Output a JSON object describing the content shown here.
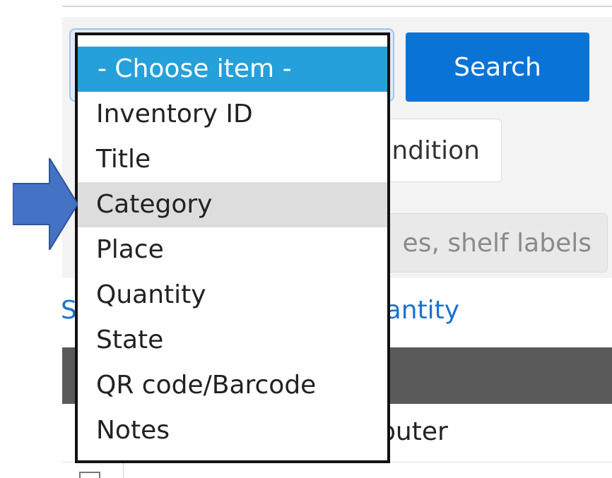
{
  "form": {
    "search_label": "Search",
    "condition_label": "ndition",
    "keyword_placeholder": "es, shelf labels",
    "link_left": "S",
    "link_quantity": "quantity"
  },
  "table": {
    "row_visible_text": "mputer"
  },
  "dropdown": {
    "selected": "- Choose item -",
    "hovered": "Category",
    "options": [
      "- Choose item -",
      "Inventory ID",
      "Title",
      "Category",
      "Place",
      "Quantity",
      "State",
      "QR code/Barcode",
      "Notes"
    ]
  },
  "colors": {
    "accent": "#0a74d6",
    "selected_option": "#25a0db",
    "hover_option": "#dddddd",
    "table_header": "#5a5a5a",
    "arrow": "#4472c4"
  },
  "icons": {
    "pointer": "right-arrow-icon"
  }
}
